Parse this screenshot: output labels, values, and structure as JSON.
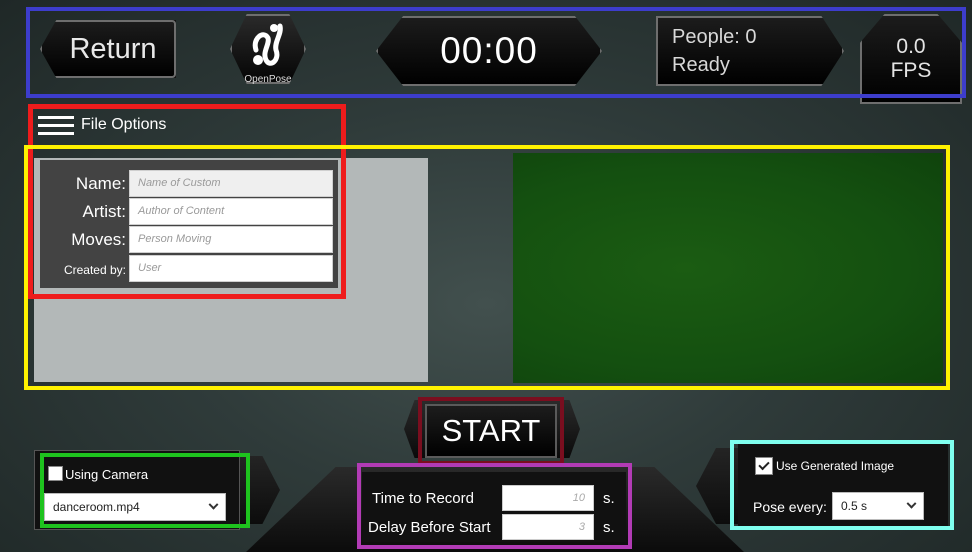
{
  "topbar": {
    "return_label": "Return",
    "logo_caption": "OpenPose",
    "timer": "00:00",
    "people": "People: 0",
    "status": "Ready",
    "fps_value": "0.0",
    "fps_unit": "FPS"
  },
  "file_options": {
    "label": "File Options",
    "fields": [
      {
        "label": "Name:",
        "placeholder": "Name of Custom"
      },
      {
        "label": "Artist:",
        "placeholder": "Author of Content"
      },
      {
        "label": "Moves:",
        "placeholder": "Person Moving"
      },
      {
        "label": "Created by:",
        "placeholder": "User"
      }
    ]
  },
  "start_label": "START",
  "camera": {
    "checkbox_label": "Using Camera",
    "checked": false,
    "video_file": "danceroom.mp4"
  },
  "recording": {
    "time_label": "Time to Record",
    "time_value": "10",
    "delay_label": "Delay Before Start",
    "delay_value": "3",
    "unit": "s."
  },
  "pose": {
    "generated_label": "Use Generated Image",
    "generated_checked": true,
    "every_label": "Pose every:",
    "every_value": "0.5 s"
  },
  "colors": {
    "annotation_blue": "#3d3dcc",
    "annotation_red": "#ee1c1c",
    "annotation_yellow": "#fff200",
    "annotation_darkred": "#7a0e1f",
    "annotation_green": "#1ec31e",
    "annotation_purple": "#b23bb5",
    "annotation_cyan": "#7fffef",
    "preview_green": "#145010",
    "preview_gray": "#b3b8b8"
  }
}
